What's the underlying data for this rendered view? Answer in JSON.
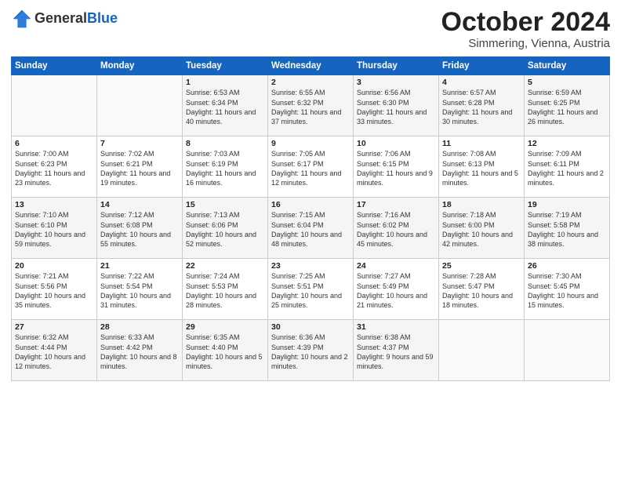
{
  "header": {
    "logo_line1": "General",
    "logo_line2": "Blue",
    "month": "October 2024",
    "location": "Simmering, Vienna, Austria"
  },
  "weekdays": [
    "Sunday",
    "Monday",
    "Tuesday",
    "Wednesday",
    "Thursday",
    "Friday",
    "Saturday"
  ],
  "weeks": [
    [
      {
        "day": "",
        "info": ""
      },
      {
        "day": "",
        "info": ""
      },
      {
        "day": "1",
        "info": "Sunrise: 6:53 AM\nSunset: 6:34 PM\nDaylight: 11 hours and 40 minutes."
      },
      {
        "day": "2",
        "info": "Sunrise: 6:55 AM\nSunset: 6:32 PM\nDaylight: 11 hours and 37 minutes."
      },
      {
        "day": "3",
        "info": "Sunrise: 6:56 AM\nSunset: 6:30 PM\nDaylight: 11 hours and 33 minutes."
      },
      {
        "day": "4",
        "info": "Sunrise: 6:57 AM\nSunset: 6:28 PM\nDaylight: 11 hours and 30 minutes."
      },
      {
        "day": "5",
        "info": "Sunrise: 6:59 AM\nSunset: 6:25 PM\nDaylight: 11 hours and 26 minutes."
      }
    ],
    [
      {
        "day": "6",
        "info": "Sunrise: 7:00 AM\nSunset: 6:23 PM\nDaylight: 11 hours and 23 minutes."
      },
      {
        "day": "7",
        "info": "Sunrise: 7:02 AM\nSunset: 6:21 PM\nDaylight: 11 hours and 19 minutes."
      },
      {
        "day": "8",
        "info": "Sunrise: 7:03 AM\nSunset: 6:19 PM\nDaylight: 11 hours and 16 minutes."
      },
      {
        "day": "9",
        "info": "Sunrise: 7:05 AM\nSunset: 6:17 PM\nDaylight: 11 hours and 12 minutes."
      },
      {
        "day": "10",
        "info": "Sunrise: 7:06 AM\nSunset: 6:15 PM\nDaylight: 11 hours and 9 minutes."
      },
      {
        "day": "11",
        "info": "Sunrise: 7:08 AM\nSunset: 6:13 PM\nDaylight: 11 hours and 5 minutes."
      },
      {
        "day": "12",
        "info": "Sunrise: 7:09 AM\nSunset: 6:11 PM\nDaylight: 11 hours and 2 minutes."
      }
    ],
    [
      {
        "day": "13",
        "info": "Sunrise: 7:10 AM\nSunset: 6:10 PM\nDaylight: 10 hours and 59 minutes."
      },
      {
        "day": "14",
        "info": "Sunrise: 7:12 AM\nSunset: 6:08 PM\nDaylight: 10 hours and 55 minutes."
      },
      {
        "day": "15",
        "info": "Sunrise: 7:13 AM\nSunset: 6:06 PM\nDaylight: 10 hours and 52 minutes."
      },
      {
        "day": "16",
        "info": "Sunrise: 7:15 AM\nSunset: 6:04 PM\nDaylight: 10 hours and 48 minutes."
      },
      {
        "day": "17",
        "info": "Sunrise: 7:16 AM\nSunset: 6:02 PM\nDaylight: 10 hours and 45 minutes."
      },
      {
        "day": "18",
        "info": "Sunrise: 7:18 AM\nSunset: 6:00 PM\nDaylight: 10 hours and 42 minutes."
      },
      {
        "day": "19",
        "info": "Sunrise: 7:19 AM\nSunset: 5:58 PM\nDaylight: 10 hours and 38 minutes."
      }
    ],
    [
      {
        "day": "20",
        "info": "Sunrise: 7:21 AM\nSunset: 5:56 PM\nDaylight: 10 hours and 35 minutes."
      },
      {
        "day": "21",
        "info": "Sunrise: 7:22 AM\nSunset: 5:54 PM\nDaylight: 10 hours and 31 minutes."
      },
      {
        "day": "22",
        "info": "Sunrise: 7:24 AM\nSunset: 5:53 PM\nDaylight: 10 hours and 28 minutes."
      },
      {
        "day": "23",
        "info": "Sunrise: 7:25 AM\nSunset: 5:51 PM\nDaylight: 10 hours and 25 minutes."
      },
      {
        "day": "24",
        "info": "Sunrise: 7:27 AM\nSunset: 5:49 PM\nDaylight: 10 hours and 21 minutes."
      },
      {
        "day": "25",
        "info": "Sunrise: 7:28 AM\nSunset: 5:47 PM\nDaylight: 10 hours and 18 minutes."
      },
      {
        "day": "26",
        "info": "Sunrise: 7:30 AM\nSunset: 5:45 PM\nDaylight: 10 hours and 15 minutes."
      }
    ],
    [
      {
        "day": "27",
        "info": "Sunrise: 6:32 AM\nSunset: 4:44 PM\nDaylight: 10 hours and 12 minutes."
      },
      {
        "day": "28",
        "info": "Sunrise: 6:33 AM\nSunset: 4:42 PM\nDaylight: 10 hours and 8 minutes."
      },
      {
        "day": "29",
        "info": "Sunrise: 6:35 AM\nSunset: 4:40 PM\nDaylight: 10 hours and 5 minutes."
      },
      {
        "day": "30",
        "info": "Sunrise: 6:36 AM\nSunset: 4:39 PM\nDaylight: 10 hours and 2 minutes."
      },
      {
        "day": "31",
        "info": "Sunrise: 6:38 AM\nSunset: 4:37 PM\nDaylight: 9 hours and 59 minutes."
      },
      {
        "day": "",
        "info": ""
      },
      {
        "day": "",
        "info": ""
      }
    ]
  ]
}
